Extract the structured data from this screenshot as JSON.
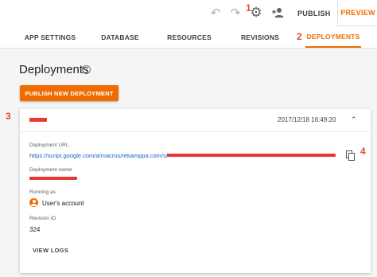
{
  "toolbar": {
    "publish_label": "PUBLISH",
    "preview_label": "PREVIEW",
    "undo_icon": "undo-icon",
    "redo_icon": "redo-icon",
    "settings_icon": "gear-icon",
    "add_person_icon": "add-person-icon"
  },
  "annotations": {
    "a1": "1",
    "a2": "2",
    "a3": "3",
    "a4": "4"
  },
  "tabs": [
    {
      "label": "APP SETTINGS"
    },
    {
      "label": "DATABASE"
    },
    {
      "label": "RESOURCES"
    },
    {
      "label": "REVISIONS"
    },
    {
      "label": "DEPLOYMENTS",
      "active": true
    }
  ],
  "page": {
    "title": "Deployments",
    "help_icon": "help-icon",
    "publish_new_label": "PUBLISH NEW DEPLOYMENT"
  },
  "deployment": {
    "date": "2017/12/18 16:49:20",
    "url_label": "Deployment URL",
    "url_visible": "https://script.google.com/a/macros/rekamppa.com/s/",
    "owner_label": "Deployment owner",
    "running_label": "Running as",
    "running_value": "User's account",
    "revision_label": "Revision ID",
    "revision_value": "324",
    "view_logs_label": "VIEW LOGS",
    "copy_icon": "copy-icon",
    "chevron_icon": "chevron-up-icon"
  },
  "colors": {
    "accent": "#ef6c00",
    "annotation": "#e8492c",
    "link": "#1565c0",
    "redaction": "#e53935"
  }
}
